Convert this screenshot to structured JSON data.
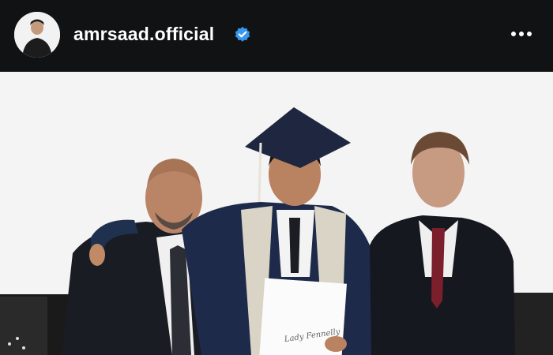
{
  "header": {
    "username": "amrsaad.official",
    "verified": true,
    "verified_color": "#3897f0",
    "more_icon": "more-horizontal-icon",
    "avatar_icon": "profile-avatar"
  },
  "post": {
    "image_description_icon": "post-photo",
    "diploma_signature": "Lady Fennelly"
  },
  "colors": {
    "header_bg": "#111213",
    "photo_bg": "#f3f3f3",
    "suit_dark": "#1a1c24",
    "gown": "#1e2a4a",
    "sash": "#d9d4c6",
    "tie_red": "#7a1f2b"
  }
}
